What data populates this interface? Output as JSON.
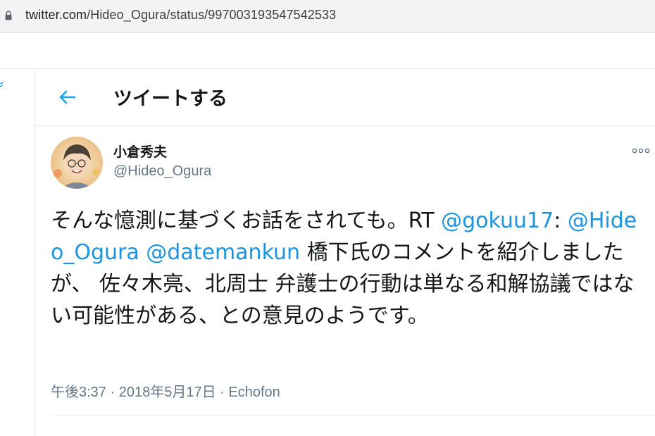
{
  "browser": {
    "url_host": "twitter.com",
    "url_path": "/Hideo_Ogura/status/997003193547542533"
  },
  "header": {
    "title": "ツイートする",
    "back_icon": "arrow-left-icon"
  },
  "tweet": {
    "author_name": "小倉秀夫",
    "author_handle": "@Hideo_Ogura",
    "text_1": "そんな憶測に基づくお話をされても。RT ",
    "mention_1": "@gokuu17",
    "text_2": ": ",
    "mention_2": "@Hideo_Ogura",
    "text_3": " ",
    "mention_3": "@datemankun",
    "text_4": " 橋下氏のコメントを紹介しましたが、 佐々木亮、北周士 弁護士の行動は単なる和解協議ではない可能性がある、との意見のようです。",
    "time": "午後3:37",
    "sep_1": " · ",
    "date": "2018年5月17日",
    "sep_2": " · ",
    "client": "Echofon"
  },
  "colors": {
    "accent": "#1da1f2",
    "link": "#1b95e0",
    "text": "#14171a",
    "muted": "#657786"
  }
}
